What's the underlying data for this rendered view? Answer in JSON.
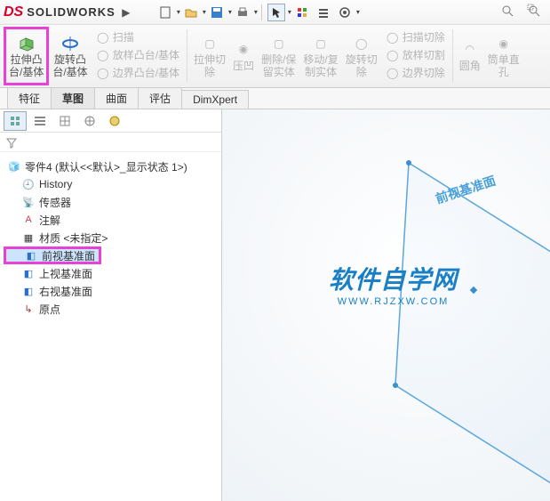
{
  "topbar": {
    "brand_prefix": "SOLID",
    "brand_suffix": "WORKS"
  },
  "ribbon": {
    "extrude": "拉伸凸\n台/基体",
    "revolve": "旋转凸\n台/基体",
    "sweep": "扫描",
    "loft": "放样凸台/基体",
    "boundary": "边界凸台/基体",
    "extrude_cut": "拉伸切\n除",
    "hole": "压凹",
    "delete_keep": "删除/保\n留实体",
    "move_copy": "移动/复\n制实体",
    "rev_cut": "旋转切\n除",
    "sweep_cut": "扫描切除",
    "loft_cut": "放样切割",
    "boundary_cut": "边界切除",
    "fillet": "圆角",
    "chamfer": "筒单直\n孔"
  },
  "tabs": {
    "t0": "特征",
    "t1": "草图",
    "t2": "曲面",
    "t3": "评估",
    "t4": "DimXpert"
  },
  "tree": {
    "root": "零件4 (默认<<默认>_显示状态 1>)",
    "history": "History",
    "sensor": "传感器",
    "annot": "注解",
    "material": "材质 <未指定>",
    "front_plane": "前视基准面",
    "top_plane": "上视基准面",
    "right_plane": "右视基准面",
    "origin": "原点"
  },
  "viewport": {
    "plane_label": "前视基准面",
    "watermark_title": "软件自学网",
    "watermark_url": "WWW.RJZXW.COM"
  }
}
